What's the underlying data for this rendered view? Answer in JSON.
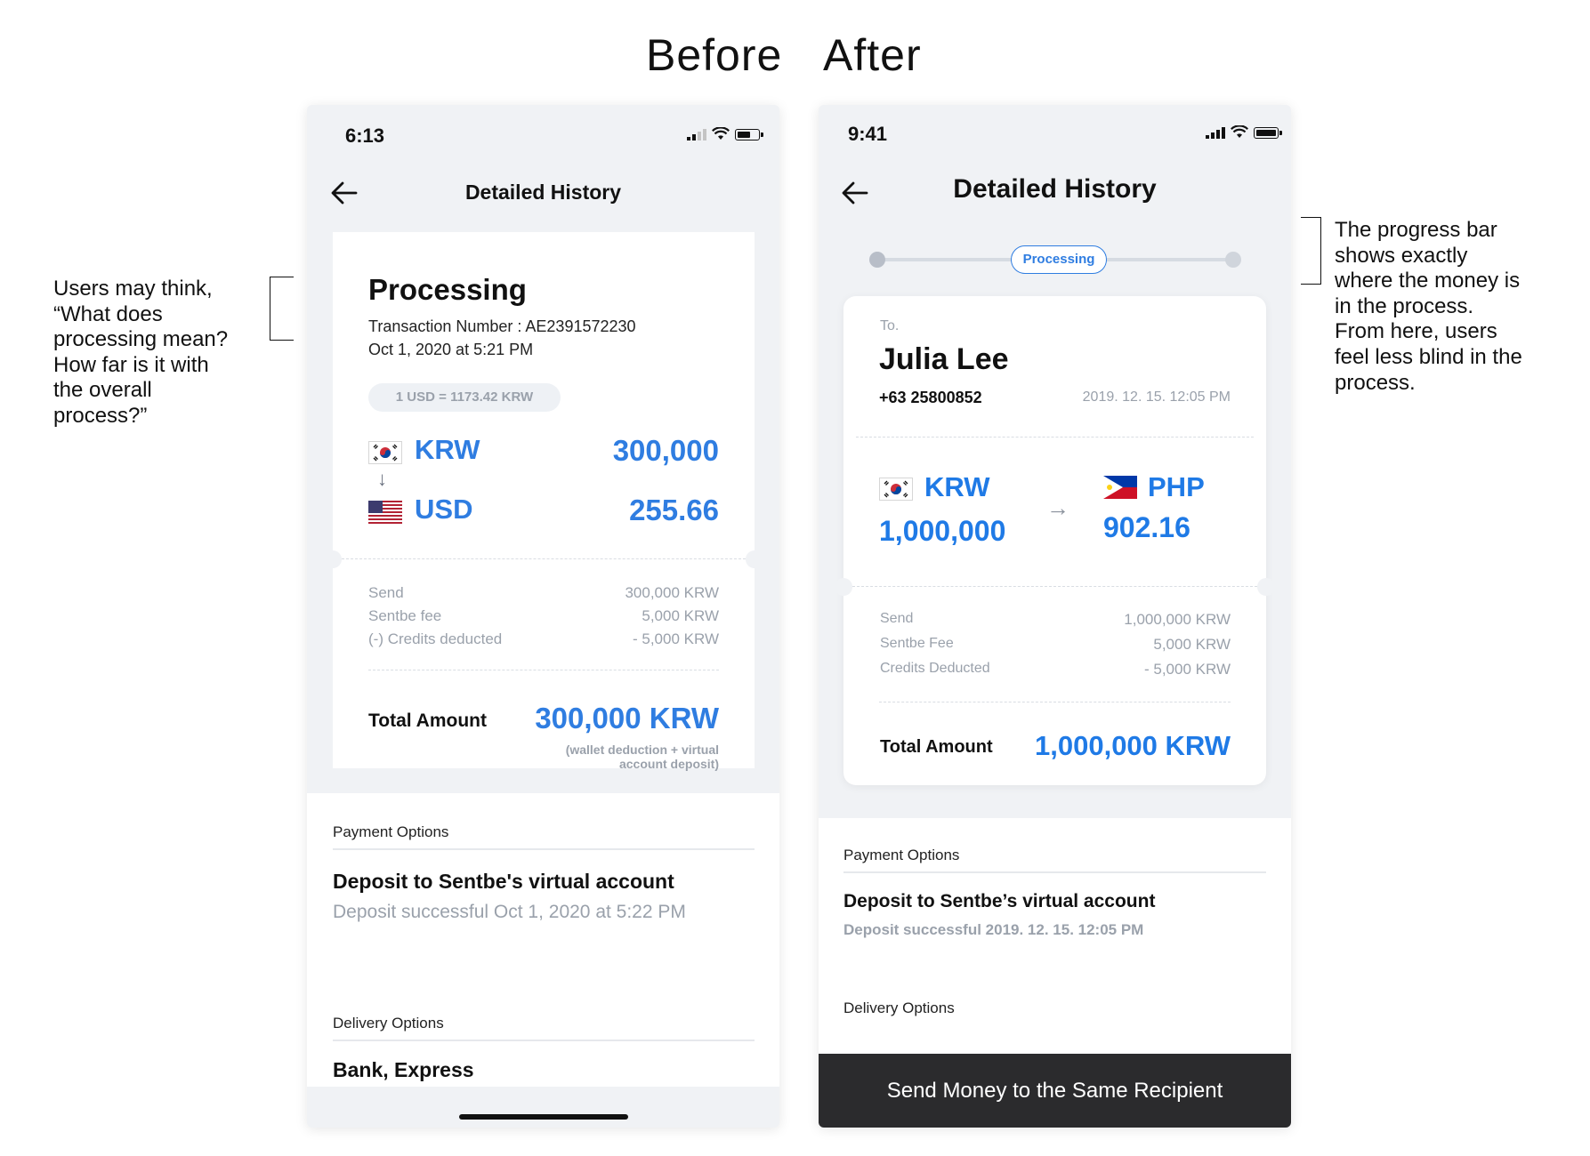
{
  "headings": {
    "before": "Before",
    "after": "After"
  },
  "notes": {
    "left": [
      "Users may think,",
      "“What does",
      "processing mean?",
      "How far is it with",
      "the overall",
      "process?”"
    ],
    "right": [
      "The progress bar",
      "shows exactly",
      "where the money is",
      "in the process.",
      "From here, users",
      "feel less blind in the",
      "process."
    ]
  },
  "before": {
    "status_time": "6:13",
    "title": "Detailed History",
    "status": "Processing",
    "transaction": "Transaction Number : AE2391572230",
    "date": "Oct 1, 2020 at 5:21 PM",
    "rate_chip": "1 USD = 1173.42 KRW",
    "from": {
      "currency": "KRW",
      "amount": "300,000",
      "flag": "korea-flag-icon"
    },
    "to": {
      "currency": "USD",
      "amount": "255.66",
      "flag": "usa-flag-icon"
    },
    "fees": [
      {
        "label": "Send",
        "value": "300,000 KRW"
      },
      {
        "label": "Sentbe fee",
        "value": "5,000 KRW"
      },
      {
        "label": "(-) Credits deducted",
        "value": "- 5,000 KRW"
      }
    ],
    "total_label": "Total Amount",
    "total_value": "300,000 KRW",
    "total_note_1": "(wallet deduction + virtual",
    "total_note_2": "account deposit)",
    "payment_label": "Payment Options",
    "payment_title": "Deposit to Sentbe's virtual account",
    "payment_sub": "Deposit successful Oct 1, 2020 at 5:22 PM",
    "delivery_label": "Delivery Options",
    "delivery_title": "Bank, Express"
  },
  "after": {
    "status_time": "9:41",
    "title": "Detailed History",
    "progress": {
      "label": "Processing",
      "steps": 3,
      "current": 2
    },
    "to_label": "To.",
    "recipient": "Julia Lee",
    "phone": "+63 25800852",
    "date": "2019. 12. 15. 12:05 PM",
    "from": {
      "currency": "KRW",
      "amount": "1,000,000",
      "flag": "korea-flag-icon"
    },
    "to": {
      "currency": "PHP",
      "amount": "902.16",
      "flag": "philippines-flag-icon"
    },
    "fees": [
      {
        "label": "Send",
        "value": "1,000,000 KRW"
      },
      {
        "label": "Sentbe Fee",
        "value": "5,000 KRW"
      },
      {
        "label": "Credits Deducted",
        "value": "- 5,000 KRW"
      }
    ],
    "total_label": "Total Amount",
    "total_value": "1,000,000 KRW",
    "payment_label": "Payment Options",
    "payment_title": "Deposit to Sentbe’s virtual account",
    "payment_sub": "Deposit successful 2019. 12. 15. 12:05 PM",
    "delivery_label": "Delivery Options",
    "cta": "Send Money to the Same Recipient"
  },
  "colors": {
    "accent": "#2f7de1",
    "muted": "#9aa1ab",
    "cta_bg": "#2b2b2d"
  }
}
